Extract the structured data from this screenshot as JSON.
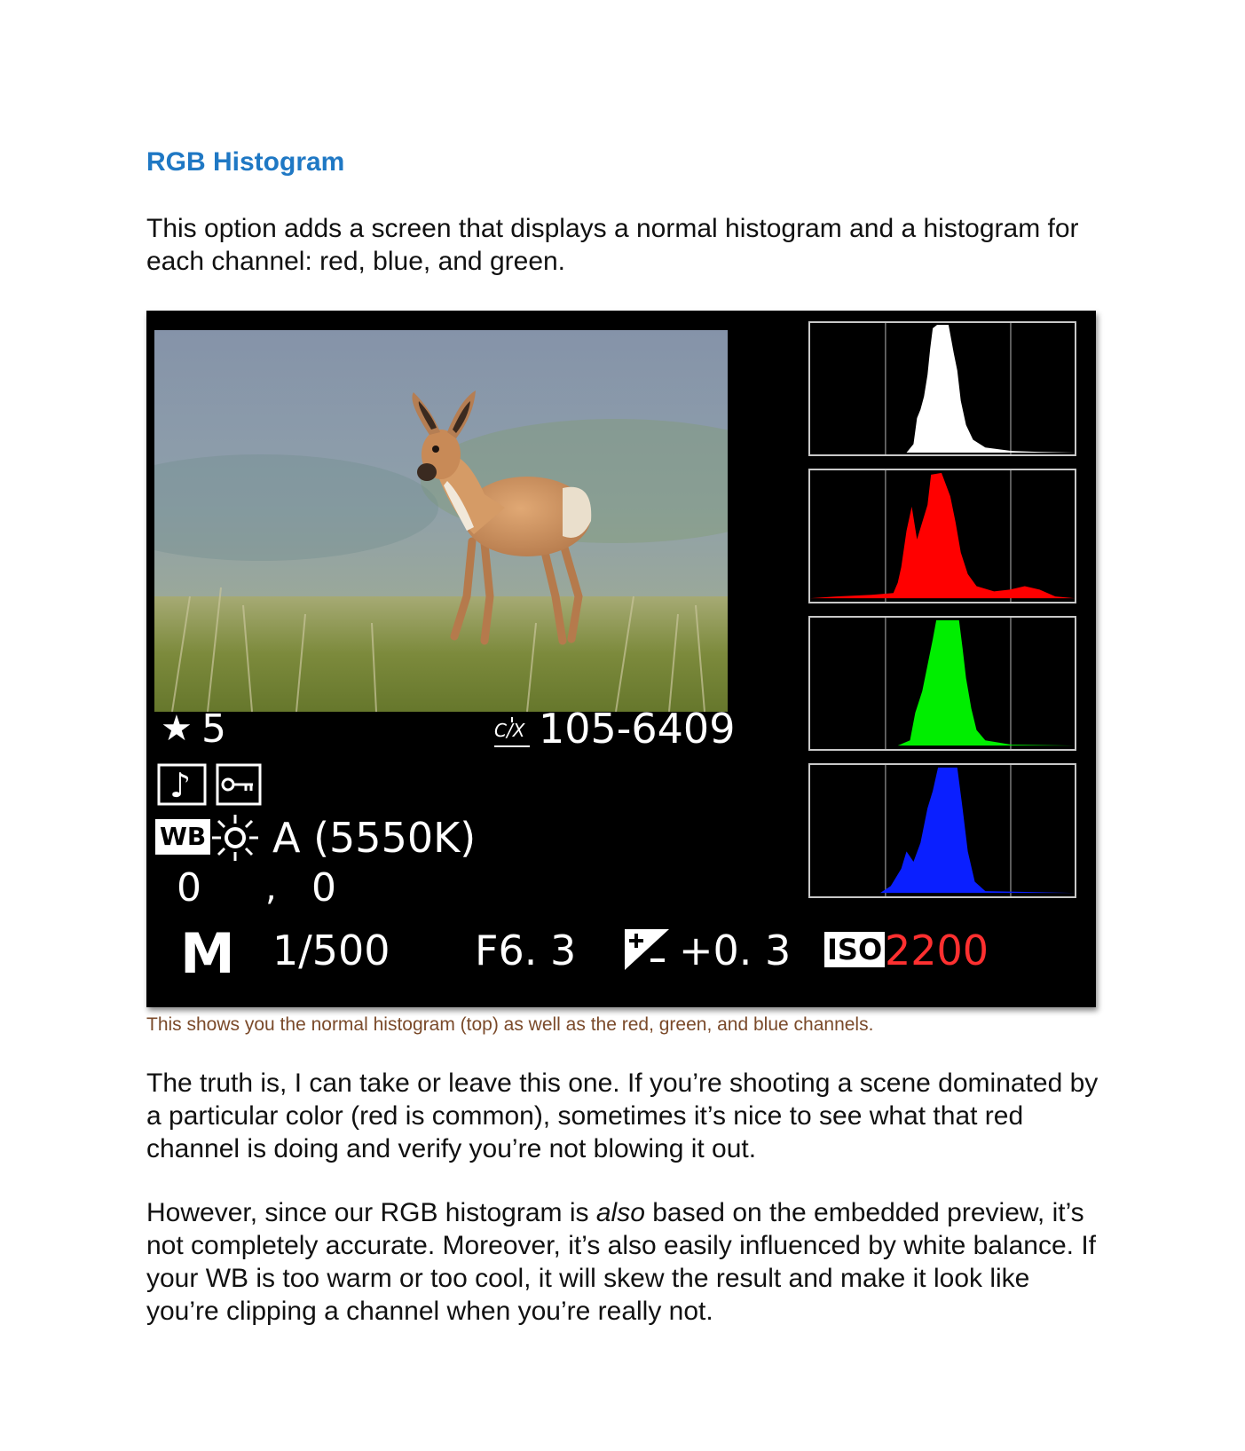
{
  "heading": "RGB Histogram",
  "intro": "This option adds a screen that displays a normal histogram and a histogram for each channel: red, blue, and green.",
  "figure": {
    "rating_star": "★",
    "rating": "5",
    "file_number": "105-6409",
    "wb_label": "WB",
    "wb_setting": "A (5550K)",
    "wb_shift_a": "0",
    "wb_shift_sep": ",",
    "wb_shift_b": "0",
    "mode": "M",
    "shutter": "1/500",
    "aperture": "F6. 3",
    "exposure_comp": "+0. 3",
    "iso_label": "ISO",
    "iso_value": "2200",
    "histograms": [
      {
        "channel": "brightness",
        "color": "#ffffff"
      },
      {
        "channel": "red",
        "color": "#ff0000"
      },
      {
        "channel": "green",
        "color": "#00ee00"
      },
      {
        "channel": "blue",
        "color": "#0a1fff"
      }
    ]
  },
  "caption": "This shows you the normal histogram (top) as well as the red, green, and blue channels.",
  "body_p2": "The truth is, I can take or leave this one. If you’re shooting a scene dominated by a particular color (red is common), sometimes it’s nice to see what that red channel is doing and verify you’re not blowing it out.",
  "body_p3": {
    "before": "However, since our RGB histogram is ",
    "emphasis": "also",
    "after": " based on the embedded preview, it’s not completely accurate. Moreover, it’s also easily influenced by white balance. If your WB is too warm or too cool, it will skew the result and make it look like you’re clipping a channel when you’re really not."
  }
}
